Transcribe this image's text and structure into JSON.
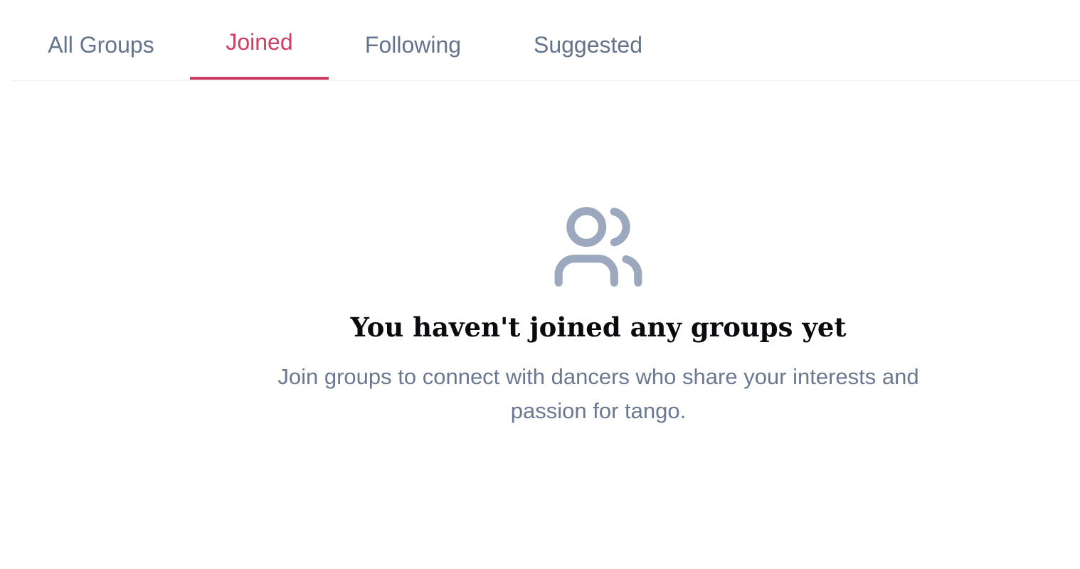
{
  "tabs": [
    {
      "label": "All Groups",
      "active": false
    },
    {
      "label": "Joined",
      "active": true
    },
    {
      "label": "Following",
      "active": false
    },
    {
      "label": "Suggested",
      "active": false
    }
  ],
  "colors": {
    "accent": "#d13d62",
    "tab_inactive": "#64748b",
    "icon": "#9ca8bd",
    "description": "#6b7891",
    "title": "#0b0b0f"
  },
  "empty_state": {
    "icon": "users-icon",
    "title": "You haven't joined any groups yet",
    "description": "Join groups to connect with dancers who share your interests and passion for tango."
  }
}
